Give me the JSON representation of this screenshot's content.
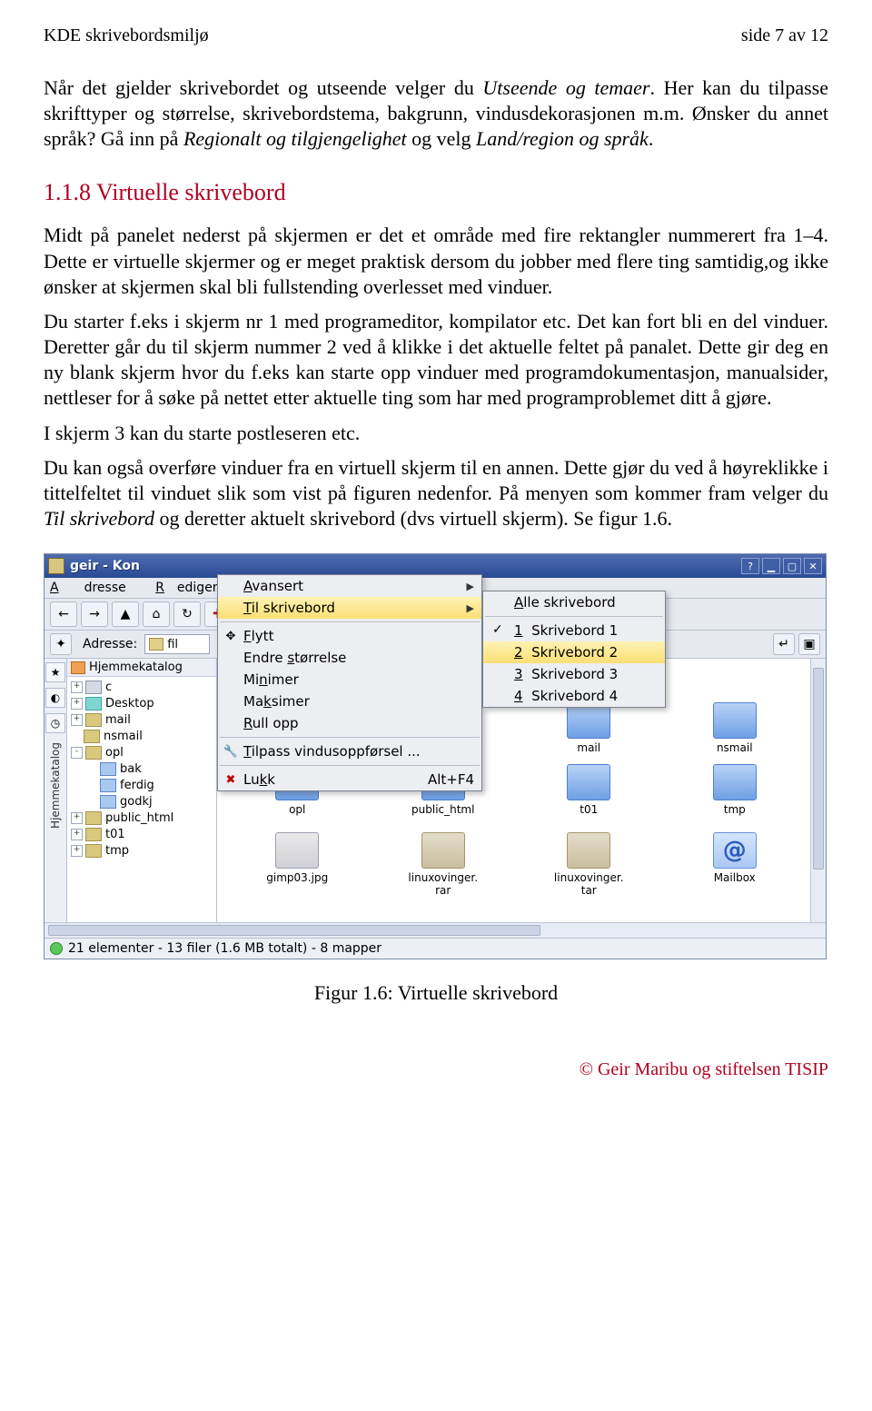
{
  "header": {
    "left": "KDE skrivebordsmiljø",
    "right": "side 7 av 12"
  },
  "para": {
    "p1a": "Når det gjelder skrivebordet og utseende velger du ",
    "p1_it1": "Utseende og temaer",
    "p1b": ". Her kan du tilpasse skrifttyper og størrelse, skrivebordstema, bakgrunn, vindusdekorasjonen m.m. Ønsker du annet språk? Gå inn på ",
    "p1_it2": "Regionalt og tilgjengelighet",
    "p1c": " og velg ",
    "p1_it3": "Land/region og språk",
    "p1d": "."
  },
  "heading": "1.1.8  Virtuelle skrivebord",
  "para2": {
    "p2": "Midt på panelet nederst på skjermen er det et område med fire rektangler nummerert fra 1–4. Dette er virtuelle skjermer og er meget praktisk dersom du jobber med flere ting samtidig,og ikke ønsker at skjermen skal bli fullstending overlesset med vinduer.",
    "p3": "Du starter f.eks i skjerm nr 1 med programeditor, kompilator etc. Det kan fort bli en del vinduer. Deretter går du til skjerm nummer 2 ved å klikke i det aktuelle feltet på panalet. Dette gir deg en ny blank skjerm hvor du f.eks kan starte opp vinduer med programdokumentasjon, manualsider, nettleser for å søke på nettet etter aktuelle ting som har med programproblemet ditt å gjøre.",
    "p4": "I skjerm 3 kan du starte postleseren etc.",
    "p5a": "Du kan også overføre vinduer fra en virtuell skjerm til en annen. Dette gjør du ved å høyreklikke i tittelfeltet til vinduet slik som vist på figuren nedenfor. På menyen som kommer fram velger du ",
    "p5_it1": "Til skrivebord",
    "p5b": " og deretter aktuelt skrivebord (dvs virtuell skjerm). Se figur 1.6."
  },
  "window": {
    "title": "geir - Kon",
    "menubar": {
      "adresse": "Adresse",
      "rediger": "Rediger"
    },
    "toolbar": {
      "back": "←",
      "forward": "→",
      "up": "▲",
      "home": "⌂",
      "reload": "↻",
      "plus": "✚"
    },
    "address": {
      "label": "Adresse:",
      "value": "fil"
    },
    "right_icons": {
      "mail_lbl": "mail",
      "nsmail_lbl": "nsmail"
    },
    "grid_row2": {
      "opl": "opl",
      "public_html": "public_html",
      "t01": "t01",
      "tmp": "tmp"
    },
    "grid_row3": {
      "gimp": "gimp03.jpg",
      "lrar": "linuxovinger.\nrar",
      "ltar": "linuxovinger.\ntar",
      "mailbox": "Mailbox"
    },
    "statusbar": "21 elementer -  13 filer (1.6 MB totalt) - 8 mapper"
  },
  "tree": {
    "header": "Hjemmekatalog",
    "items": [
      {
        "label": "c",
        "icon": "drive",
        "exp": "+",
        "indent": 0
      },
      {
        "label": "Desktop",
        "icon": "teal",
        "exp": "+",
        "indent": 0
      },
      {
        "label": "mail",
        "icon": "folder",
        "exp": "+",
        "indent": 0
      },
      {
        "label": "nsmail",
        "icon": "folder",
        "exp": "",
        "indent": 0
      },
      {
        "label": "opl",
        "icon": "folder",
        "exp": "-",
        "indent": 0
      },
      {
        "label": "bak",
        "icon": "blue",
        "exp": "",
        "indent": 1
      },
      {
        "label": "ferdig",
        "icon": "blue",
        "exp": "",
        "indent": 1
      },
      {
        "label": "godkj",
        "icon": "blue",
        "exp": "",
        "indent": 1
      },
      {
        "label": "public_html",
        "icon": "folder",
        "exp": "+",
        "indent": 0
      },
      {
        "label": "t01",
        "icon": "folder",
        "exp": "+",
        "indent": 0
      },
      {
        "label": "tmp",
        "icon": "folder",
        "exp": "+",
        "indent": 0
      }
    ]
  },
  "menu": {
    "avansert": "Avansert",
    "tilskrivebord": "Til skrivebord",
    "flytt": "Flytt",
    "endre": "Endre størrelse",
    "minimer": "Minimer",
    "maksimer": "Maksimer",
    "rull": "Rull opp",
    "tilpass": "Tilpass vindusoppførsel ...",
    "lukk": "Lukk",
    "lukk_sc": "Alt+F4"
  },
  "submenu": {
    "alle": "Alle skrivebord",
    "s1": "1  Skrivebord 1",
    "s2": "2  Skrivebord 2",
    "s3": "3  Skrivebord 3",
    "s4": "4  Skrivebord 4"
  },
  "caption": "Figur 1.6: Virtuelle skrivebord",
  "footer": "© Geir Maribu og stiftelsen TISIP"
}
